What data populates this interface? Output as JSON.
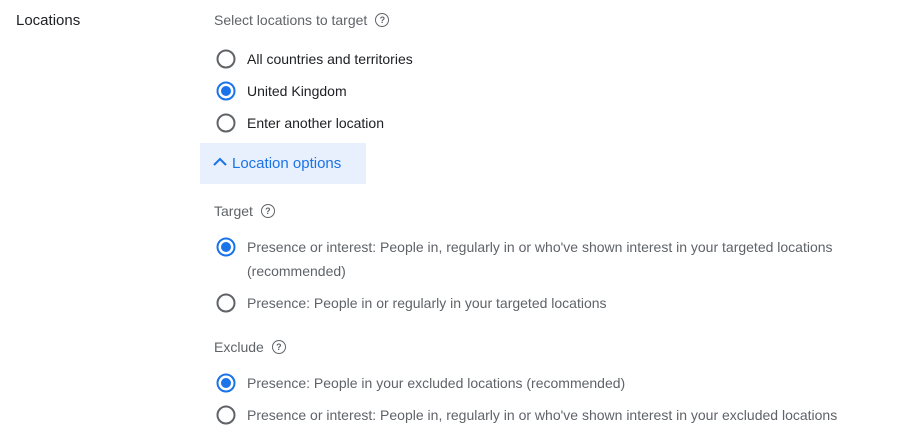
{
  "section": {
    "label": "Locations"
  },
  "locations": {
    "prompt": "Select locations to target",
    "options": [
      {
        "label": "All countries and territories",
        "selected": false
      },
      {
        "label": "United Kingdom",
        "selected": true
      },
      {
        "label": "Enter another location",
        "selected": false
      }
    ]
  },
  "location_options": {
    "label": "Location options",
    "icon": "chevron-up-icon"
  },
  "target": {
    "title": "Target",
    "options": [
      {
        "line1": "Presence or interest: People in, regularly in or who've shown interest in your targeted locations",
        "line2": "(recommended)",
        "selected": true
      },
      {
        "label": "Presence: People in or regularly in your targeted locations",
        "selected": false
      }
    ]
  },
  "exclude": {
    "title": "Exclude",
    "options": [
      {
        "label": "Presence: People in your excluded locations (recommended)",
        "selected": true
      },
      {
        "label": "Presence or interest: People in, regularly in or who've shown interest in your excluded locations",
        "selected": false
      }
    ]
  },
  "colors": {
    "accent": "#1a73e8",
    "radio_off": "#5f6368",
    "button_bg": "#e8f0fe"
  }
}
